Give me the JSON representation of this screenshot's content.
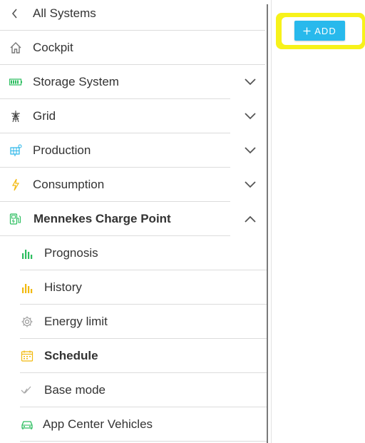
{
  "nav": {
    "back_label": "All Systems",
    "cockpit": "Cockpit",
    "storage": "Storage System",
    "grid": "Grid",
    "production": "Production",
    "consumption": "Consumption",
    "charge_point": "Mennekes Charge Point",
    "sub": {
      "prognosis": "Prognosis",
      "history": "History",
      "energy_limit": "Energy limit",
      "schedule": "Schedule",
      "base_mode": "Base mode",
      "vehicles": "App Center Vehicles"
    }
  },
  "toolbar": {
    "add_label": "ADD"
  },
  "colors": {
    "accent_blue": "#28b9ec",
    "highlight_yellow": "#f7f21a",
    "green": "#2dbe60",
    "amber": "#f2b90f"
  },
  "icons": {
    "back": "chevron-left-icon",
    "cockpit": "home-icon",
    "storage": "battery-icon",
    "grid": "power-tower-icon",
    "production": "solar-panel-icon",
    "consumption": "lightning-icon",
    "charge_point": "ev-charger-icon",
    "prognosis": "bar-chart-icon",
    "history": "bar-chart-icon",
    "energy_limit": "gear-icon",
    "schedule": "calendar-icon",
    "base_mode": "checkmark-icon",
    "vehicles": "car-icon"
  }
}
